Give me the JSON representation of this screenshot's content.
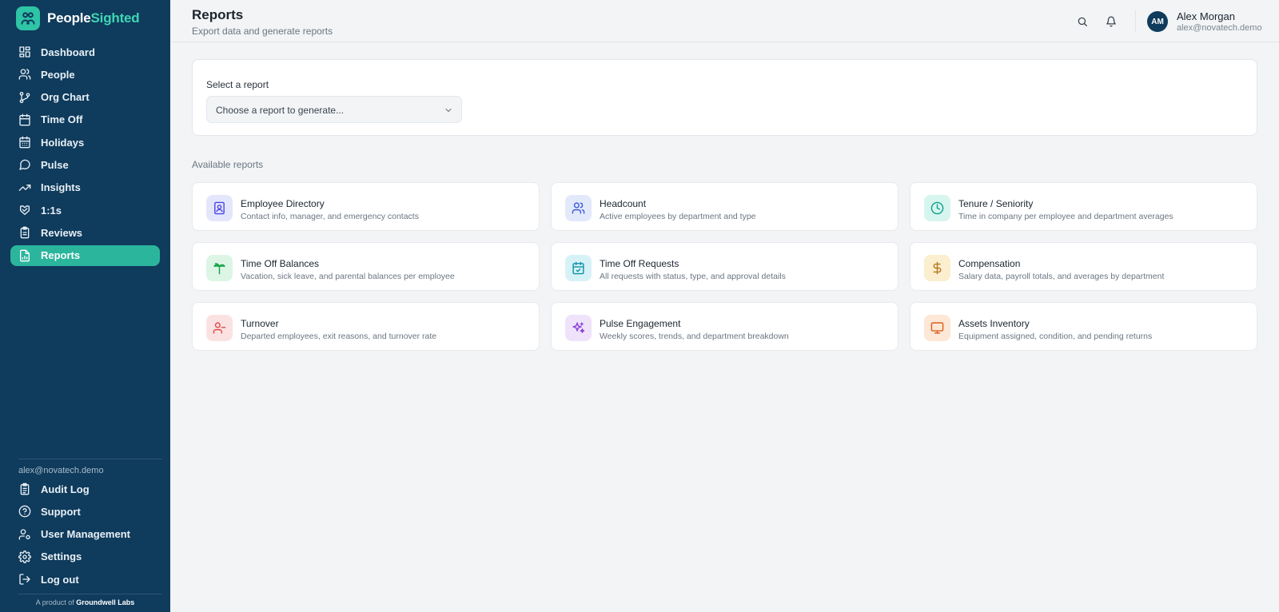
{
  "brand": {
    "part1": "People",
    "part2": "Sighted"
  },
  "sidebar": {
    "items": [
      {
        "label": "Dashboard",
        "icon": "dashboard-icon"
      },
      {
        "label": "People",
        "icon": "people-icon"
      },
      {
        "label": "Org Chart",
        "icon": "org-chart-icon"
      },
      {
        "label": "Time Off",
        "icon": "calendar-icon"
      },
      {
        "label": "Holidays",
        "icon": "calendar-grid-icon"
      },
      {
        "label": "Pulse",
        "icon": "chat-icon"
      },
      {
        "label": "Insights",
        "icon": "trending-up-icon"
      },
      {
        "label": "1:1s",
        "icon": "handshake-icon"
      },
      {
        "label": "Reviews",
        "icon": "clipboard-icon"
      },
      {
        "label": "Reports",
        "icon": "report-icon",
        "active": true
      }
    ],
    "email": "alex@novatech.demo",
    "bottom_items": [
      {
        "label": "Audit Log",
        "icon": "clipboard-list-icon"
      },
      {
        "label": "Support",
        "icon": "help-icon"
      },
      {
        "label": "User Management",
        "icon": "user-cog-icon"
      },
      {
        "label": "Settings",
        "icon": "gear-icon"
      },
      {
        "label": "Log out",
        "icon": "logout-icon"
      }
    ],
    "footer_prefix": "A product of",
    "footer_company": "Groundwell Labs"
  },
  "header": {
    "title": "Reports",
    "subtitle": "Export data and generate reports",
    "avatar_initials": "AM",
    "user_name": "Alex Morgan",
    "user_email": "alex@novatech.demo"
  },
  "select": {
    "label": "Select a report",
    "placeholder": "Choose a report to generate..."
  },
  "available_label": "Available reports",
  "reports": [
    {
      "title": "Employee Directory",
      "desc": "Contact info, manager, and emergency contacts",
      "icon": "contact-card-icon",
      "color": "#4f46e5",
      "bg": "#e4e6fb"
    },
    {
      "title": "Headcount",
      "desc": "Active employees by department and type",
      "icon": "users-icon",
      "color": "#3b5bdb",
      "bg": "#e2e9fb"
    },
    {
      "title": "Tenure / Seniority",
      "desc": "Time in company per employee and department averages",
      "icon": "clock-icon",
      "color": "#0f9f8a",
      "bg": "#d6f5ef"
    },
    {
      "title": "Time Off Balances",
      "desc": "Vacation, sick leave, and parental balances per employee",
      "icon": "palm-tree-icon",
      "color": "#16a34a",
      "bg": "#ddf5e5"
    },
    {
      "title": "Time Off Requests",
      "desc": "All requests with status, type, and approval details",
      "icon": "calendar-check-icon",
      "color": "#0e8fa8",
      "bg": "#d7f2f7"
    },
    {
      "title": "Compensation",
      "desc": "Salary data, payroll totals, and averages by department",
      "icon": "dollar-icon",
      "color": "#b7791f",
      "bg": "#fbefcf"
    },
    {
      "title": "Turnover",
      "desc": "Departed employees, exit reasons, and turnover rate",
      "icon": "user-minus-icon",
      "color": "#dc4a4a",
      "bg": "#fbe2e2"
    },
    {
      "title": "Pulse Engagement",
      "desc": "Weekly scores, trends, and department breakdown",
      "icon": "sparkles-icon",
      "color": "#8b3fd9",
      "bg": "#efe3fb"
    },
    {
      "title": "Assets Inventory",
      "desc": "Equipment assigned, condition, and pending returns",
      "icon": "monitor-icon",
      "color": "#d9601f",
      "bg": "#fde7d6"
    }
  ]
}
